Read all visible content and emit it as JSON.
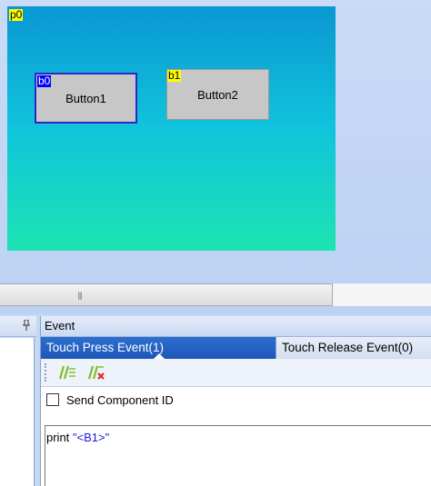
{
  "canvas": {
    "page_id": "p0",
    "buttons": [
      {
        "id": "b0",
        "label": "Button1",
        "selected": true
      },
      {
        "id": "b1",
        "label": "Button2",
        "selected": false
      }
    ],
    "gradient_top": "#0a97d2",
    "gradient_bottom": "#1de4b2"
  },
  "scrollbar": {
    "grip": "|||"
  },
  "left_panel": {
    "pin_icon": "pin-icon"
  },
  "event_panel": {
    "title": "Event",
    "tabs": [
      {
        "label": "Touch Press Event(1)",
        "active": true
      },
      {
        "label": "Touch Release Event(0)",
        "active": false
      }
    ],
    "toolbar": {
      "comment_icon": "comment-lines-icon",
      "uncomment_icon": "uncomment-lines-icon"
    },
    "send_component_id": {
      "label": "Send Component ID",
      "checked": false
    },
    "code": {
      "keyword": "print ",
      "string": "\"<B1>\""
    }
  },
  "colors": {
    "tab_active": "#2c6fd1",
    "tag_yellow": "#ffff00",
    "tag_blue": "#0000ff",
    "string_color": "#1a1adb"
  }
}
